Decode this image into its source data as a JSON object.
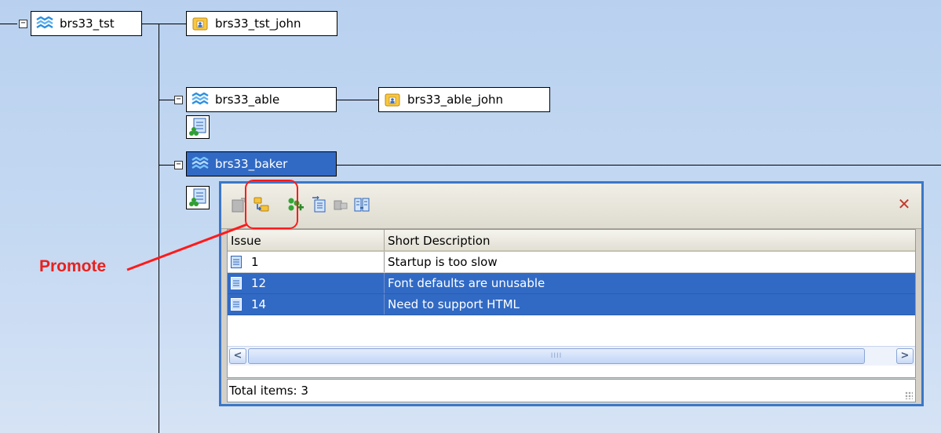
{
  "tree": {
    "nodes": [
      {
        "id": "brs33_tst",
        "label": "brs33_tst",
        "type": "stream",
        "expanded": true
      },
      {
        "id": "brs33_tst_john",
        "label": "brs33_tst_john",
        "type": "workspace"
      },
      {
        "id": "brs33_able",
        "label": "brs33_able",
        "type": "stream",
        "expanded": true
      },
      {
        "id": "brs33_able_john",
        "label": "brs33_able_john",
        "type": "workspace"
      },
      {
        "id": "brs33_baker",
        "label": "brs33_baker",
        "type": "stream",
        "expanded": true,
        "selected": true
      }
    ],
    "toggle_symbol": "−"
  },
  "panel": {
    "toolbar": [
      {
        "name": "edit-icon",
        "enabled": false
      },
      {
        "name": "promote-icon",
        "enabled": true
      },
      {
        "name": "add-issues-icon",
        "enabled": true
      },
      {
        "name": "import-icon",
        "enabled": true
      },
      {
        "name": "send-icon",
        "enabled": false
      },
      {
        "name": "compare-icon",
        "enabled": true
      }
    ],
    "close_label": "✕",
    "columns": {
      "issue": "Issue",
      "description": "Short Description"
    },
    "rows": [
      {
        "issue": "1",
        "description": "Startup is too slow",
        "selected": false
      },
      {
        "issue": "12",
        "description": "Font defaults are unusable",
        "selected": true
      },
      {
        "issue": "14",
        "description": "Need to support HTML",
        "selected": true
      }
    ],
    "scroll": {
      "left": "<",
      "right": ">",
      "grip": "IIII"
    },
    "status": "Total items: 3"
  },
  "callout": {
    "label": "Promote",
    "color": "#e8211e"
  },
  "colors": {
    "selection": "#316ac5",
    "panel_border": "#3b77c6",
    "background": "#c5d9f2"
  }
}
